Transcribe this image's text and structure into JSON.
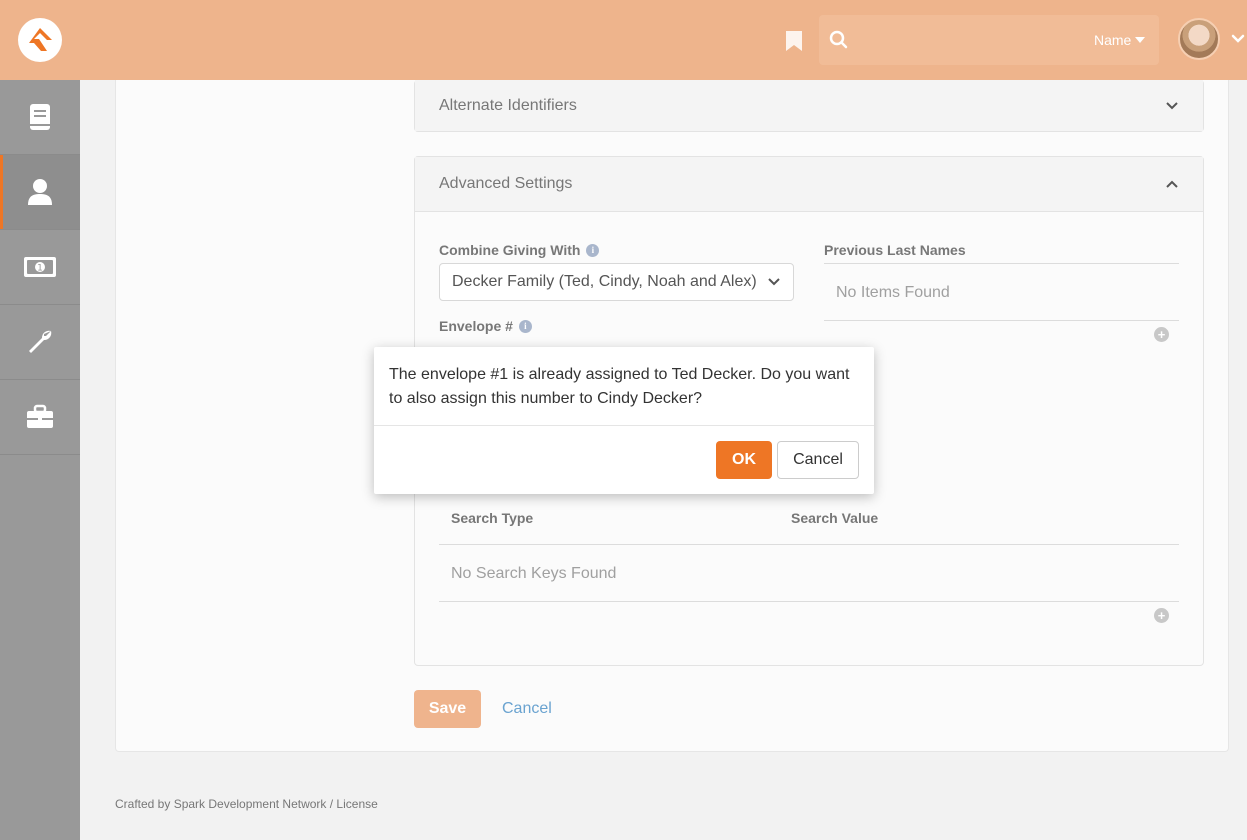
{
  "header": {
    "search_placeholder": "",
    "name_dropdown": "Name",
    "brand_color": "#eeb48c"
  },
  "sidebar": {
    "items": [
      {
        "icon": "book-icon"
      },
      {
        "icon": "person-icon",
        "active": true
      },
      {
        "icon": "money-icon"
      },
      {
        "icon": "wrench-icon"
      },
      {
        "icon": "briefcase-icon"
      }
    ]
  },
  "panels": {
    "alternate_identifiers": "Alternate Identifiers",
    "advanced_settings": "Advanced Settings"
  },
  "form": {
    "combine_giving_label": "Combine Giving With",
    "combine_giving_value": "Decker Family (Ted, Cindy, Noah and Alex)",
    "envelope_label": "Envelope #",
    "previous_last_names_label": "Previous Last Names",
    "previous_last_names_empty": "No Items Found",
    "search_type_header": "Search Type",
    "search_value_header": "Search Value",
    "search_keys_empty": "No Search Keys Found"
  },
  "actions": {
    "save": "Save",
    "cancel": "Cancel"
  },
  "footer": {
    "text": "Crafted by Spark Development Network / License"
  },
  "dialog": {
    "message": "The envelope #1 is already assigned to Ted Decker. Do you want to also assign this number to Cindy Decker?",
    "ok": "OK",
    "cancel": "Cancel"
  }
}
